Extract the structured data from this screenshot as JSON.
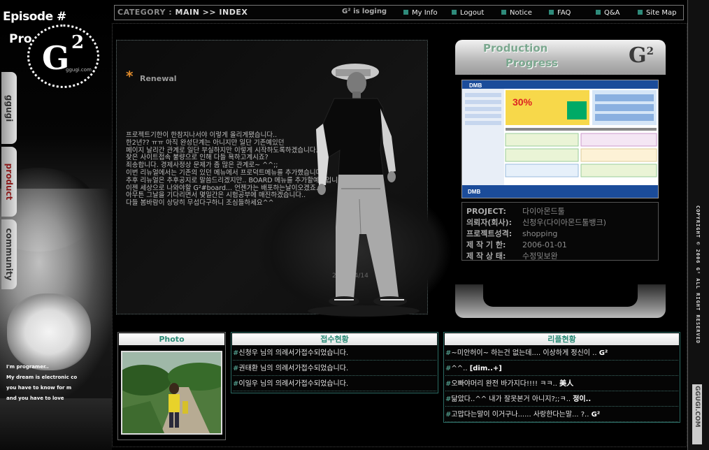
{
  "left": {
    "episode": "Episode #",
    "prog": "Pro",
    "logo_main": "G",
    "logo_sup": "2",
    "logo_site": "ggugi.com",
    "tabs": [
      "ggugi",
      "product",
      "community"
    ],
    "intro": [
      "I'm programer..",
      "My dream is electronic co",
      "you have to know for m",
      "and you have to love"
    ]
  },
  "topbar": {
    "category_label": "CATEGORY :",
    "category_path": "MAIN >> INDEX",
    "login_status": "G² is loging",
    "nav": [
      "My Info",
      "Logout",
      "Notice",
      "FAQ",
      "Q&A",
      "Site Map"
    ]
  },
  "news": {
    "title": "Renewal",
    "lines": [
      "프로젝트기한이 한참지나서야 이렇게 올리게됐습니다..",
      "한2년?? ㅠㅠ 아직 완성단계는 아니지만 일단 기존예있던",
      "페이지 날리간 관계로 일단 부실하지만 이렇게 시작하도록하겠습니다.",
      "잦은 사이트접속 불량으로 인해 다들 욕하고계시죠?",
      "죄송합니다. 경제사정상 문제가 좀 많은 관계로~ ^^;;",
      "이번 리뉴얼에서는 기존의 있던 메뉴에서 프로덕트메뉴를 추가했습니다.",
      "추후 리뉴얼은 추후공지로 말씀드리겠지만.. BOARD 메뉴를 추가할예정입니다.",
      "이젠 세상으로 나와야할 G²#board... 언젠가는 배포하는날이오겠죠..",
      "아무튼 그날을 기다리면서 몇일간은 시험공부에 매진하겠습니다..",
      "다들 봄바람이 상당히 무섭다구하니 조심들하세요^^"
    ],
    "date": "2007/04/14"
  },
  "production": {
    "title1": "Production",
    "title2": "Progress",
    "brand_g": "G",
    "brand_sup": "2",
    "info": [
      {
        "key": "PROJECT:",
        "value": "다이아몬드툴"
      },
      {
        "key": "의뢰자(회사):",
        "value": "신청우(다이아몬드툴뱅크)"
      },
      {
        "key": "프로젝트성격:",
        "value": "shopping"
      },
      {
        "key": "제 작 기 한:",
        "value": "2006-01-01"
      },
      {
        "key": "제 작 상 태:",
        "value": "수정및보완"
      }
    ],
    "shot_badge": "30%",
    "shot_logo": "DMB"
  },
  "photo": {
    "title": "Photo"
  },
  "received": {
    "title": "접수현황",
    "items": [
      "신청우 님의 의례서가접수되었습니다.",
      "권태환 님의 의례서가접수되었습니다.",
      "이일우 님의 의례서가접수되었습니다."
    ]
  },
  "replies": {
    "title": "리플현황",
    "items": [
      {
        "text": "~미안허이~ 하는건 없는데.... 이상하게 정신이 ..",
        "author": "G²"
      },
      {
        "text": "^^..",
        "author": "[dim..+]"
      },
      {
        "text": "오빠야머리 완전 바가지다!!!! ㅋㅋ..",
        "author": "美人"
      },
      {
        "text": "닮았다..^^ 내가 잘못본거 아니지?;;ㅋ..",
        "author": "정이.."
      },
      {
        "text": "고맙다는말이 이거구나...... 사랑한다는말... ?..",
        "author": "G²"
      }
    ]
  },
  "copyright": "COPYRIGHT © 2006 G² ALL RIGHT RESERVED",
  "side_brand": "GGUGI.COM",
  "colors": {
    "accent_teal": "#2e8a7a",
    "head_text": "#2b8a76",
    "star_orange": "#e08b2b"
  }
}
